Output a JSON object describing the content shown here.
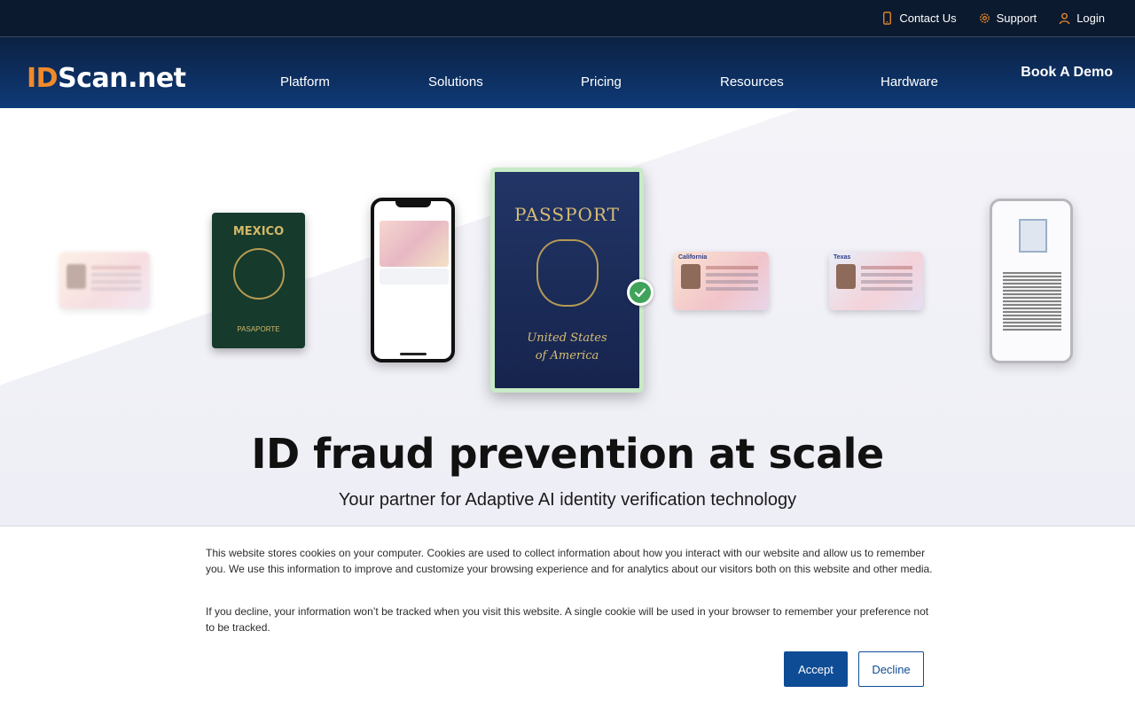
{
  "topbar": {
    "contact": {
      "label": "Contact Us",
      "icon": "phone-icon"
    },
    "support": {
      "label": "Support",
      "icon": "gear-icon"
    },
    "login": {
      "label": "Login",
      "icon": "user-icon"
    }
  },
  "nav": {
    "logo_id": "ID",
    "logo_rest": "Scan.net",
    "items": [
      "Platform",
      "Solutions",
      "Pricing",
      "Resources",
      "Hardware"
    ],
    "cta": "Book A Demo"
  },
  "hero": {
    "headline": "ID fraud prevention at scale",
    "subline": "Your partner for Adaptive AI identity verification technology",
    "mexico_passport_title": "MEXICO",
    "mexico_passport_sub": "PASAPORTE",
    "us_passport_title": "PASSPORT",
    "us_passport_sub1": "United States",
    "us_passport_sub2": "of America",
    "card_california": "California",
    "card_texas": "Texas",
    "verified_icon": "check-icon"
  },
  "cookie": {
    "text1": "This website stores cookies on your computer. Cookies are used to collect information about how you interact with our website and allow us to remember you. We use this information to improve and customize your browsing experience and for analytics about our visitors both on this website and other media.",
    "text2": "If you decline, your information won’t be tracked when you visit this website. A single cookie will be used in your browser to remember your preference not to be tracked.",
    "accept": "Accept",
    "decline": "Decline"
  },
  "colors": {
    "brand_orange": "#f08a2a",
    "nav_blue": "#0e3a78",
    "button_blue": "#0f4c96",
    "verified_green": "#3fa35a"
  }
}
